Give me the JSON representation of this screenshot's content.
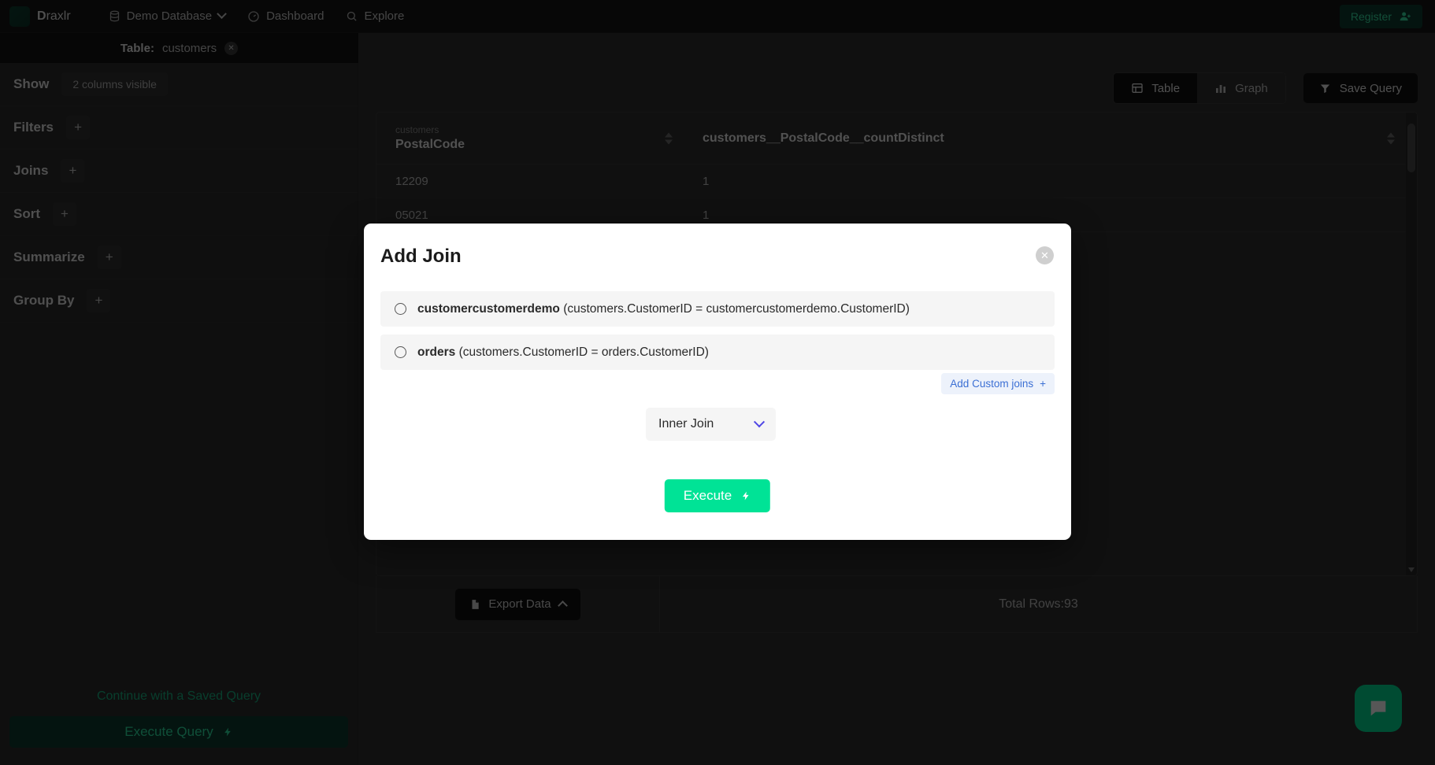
{
  "navbar": {
    "brand_initial": "D",
    "brand_rest": "raxlr",
    "database": "Demo Database",
    "dashboard": "Dashboard",
    "explore": "Explore",
    "register": "Register"
  },
  "tabbar": {
    "table_prefix": "Table:",
    "table_name": "customers"
  },
  "sidebar": {
    "rows": [
      {
        "label": "Show",
        "pill": "2 columns visible"
      },
      {
        "label": "Filters",
        "plus": "+"
      },
      {
        "label": "Joins",
        "plus": "+"
      },
      {
        "label": "Sort",
        "plus": "+"
      },
      {
        "label": "Summarize",
        "plus": "+"
      },
      {
        "label": "Group By",
        "plus": "+"
      }
    ],
    "saved_query_link": "Continue with a Saved Query",
    "execute_query": "Execute Query"
  },
  "toolbar": {
    "table_label": "Table",
    "graph_label": "Graph",
    "save_query_label": "Save Query"
  },
  "table": {
    "col1_sub": "customers",
    "col1_title": "PostalCode",
    "col2_title": "customers__PostalCode__countDistinct",
    "rows": [
      {
        "postal": "12209",
        "count": "1"
      },
      {
        "postal": "05021",
        "count": "1"
      }
    ]
  },
  "footer": {
    "export_label": "Export Data",
    "total_rows": "Total Rows:93"
  },
  "modal": {
    "title": "Add Join",
    "options": [
      {
        "name": "customercustomerdemo",
        "condition": "(customers.CustomerID = customercustomerdemo.CustomerID)"
      },
      {
        "name": "orders",
        "condition": "(customers.CustomerID = orders.CustomerID)"
      }
    ],
    "custom_join_label": "Add Custom joins",
    "custom_join_plus": "+",
    "join_type": "Inner Join",
    "execute_label": "Execute"
  },
  "colors": {
    "accent_green": "#00e396",
    "brand_dark_green": "#0d3b2e",
    "link_blue": "#3b6fd4",
    "chevron_indigo": "#4f46e5"
  }
}
